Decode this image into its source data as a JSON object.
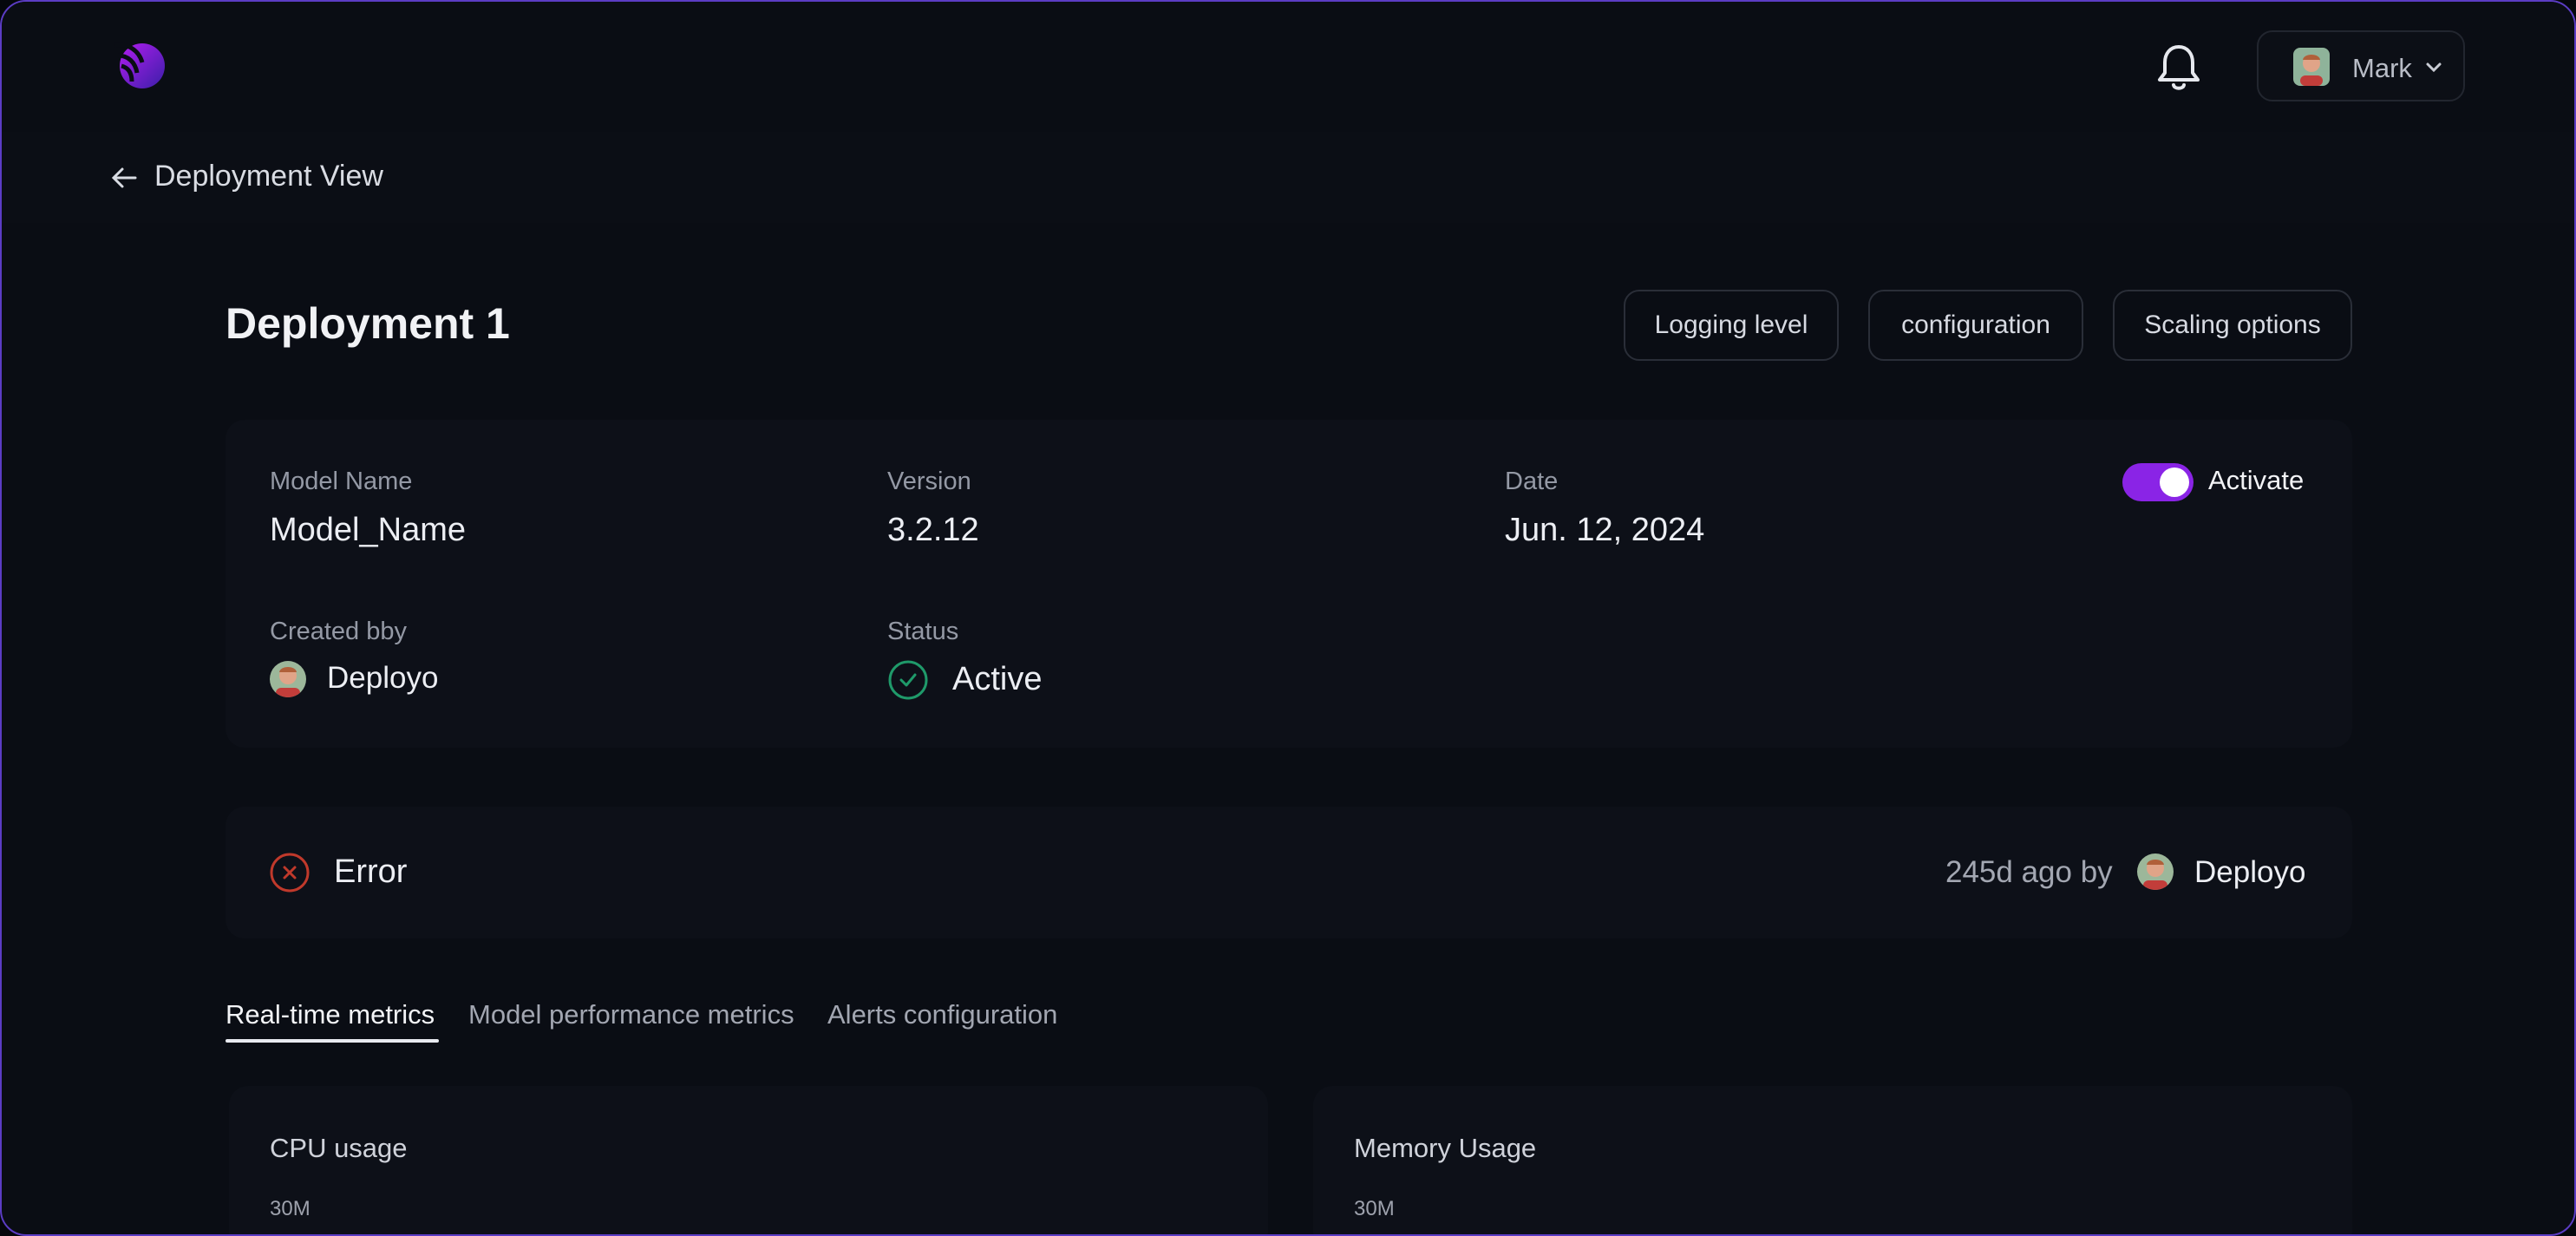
{
  "header": {
    "logo_icon": "brand-logo-icon",
    "notification_icon": "bell-icon",
    "user": {
      "name": "Mark",
      "avatar_icon": "user-avatar"
    }
  },
  "subheader": {
    "back_icon": "arrow-left-icon",
    "title": "Deployment View"
  },
  "page": {
    "title": "Deployment 1",
    "actions": [
      "Logging level",
      "configuration",
      "Scaling options"
    ]
  },
  "details": {
    "model_name_label": "Model Name",
    "model_name": "Model_Name",
    "version_label": "Version",
    "version": "3.2.12",
    "date_label": "Date",
    "date": "Jun. 12, 2024",
    "activate_label": "Activate",
    "activate_on": true,
    "created_by_label": "Created bby",
    "created_by": "Deployo",
    "status_label": "Status",
    "status": "Active"
  },
  "error_banner": {
    "label": "Error",
    "time": "245d ago by",
    "user": "Deployo"
  },
  "tabs": [
    "Real-time metrics",
    "Model performance metrics",
    "Alerts configuration"
  ],
  "active_tab": 0,
  "metrics": [
    {
      "title": "CPU usage",
      "top_tick": "30M"
    },
    {
      "title": "Memory Usage",
      "top_tick": "30M"
    }
  ],
  "colors": {
    "accent": "#8a24e6",
    "success": "#1f9a6a",
    "error": "#c0392b",
    "background": "#0a0d14"
  }
}
